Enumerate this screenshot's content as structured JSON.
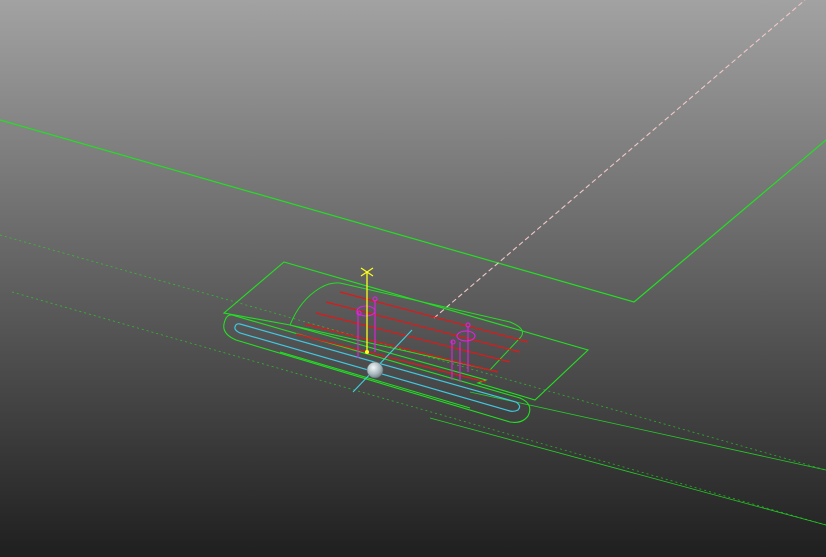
{
  "viewport": {
    "background_top": "#a2a2a2",
    "background_bottom": "#1f1f1f"
  },
  "colors": {
    "part_outline": "#22e022",
    "slot": "#3fc8e0",
    "hatch": "#e01818",
    "pin": "#e020e0",
    "triad_axis": "#ffff20",
    "cursor_axis": "#40d0e0",
    "dash_trace": "#f0c8c8"
  },
  "scene": {
    "objects": [
      {
        "name": "plate-outline",
        "icon": "wireframe-plane-icon"
      },
      {
        "name": "slotted-part",
        "icon": "slotted-part-icon"
      },
      {
        "name": "origin-triad",
        "icon": "axis-triad-icon"
      },
      {
        "name": "pick-sphere",
        "icon": "sphere-icon"
      }
    ]
  }
}
